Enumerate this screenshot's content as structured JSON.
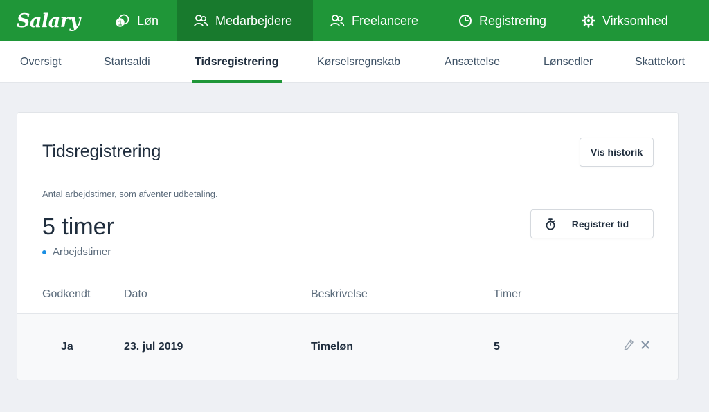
{
  "brand": {
    "logo": "Salary"
  },
  "topnav": [
    {
      "label": "Løn",
      "icon": "coin-icon",
      "active": false
    },
    {
      "label": "Medarbejdere",
      "icon": "users-icon",
      "active": true
    },
    {
      "label": "Freelancere",
      "icon": "users-icon",
      "active": false
    },
    {
      "label": "Registrering",
      "icon": "clock-icon",
      "active": false
    },
    {
      "label": "Virksomhed",
      "icon": "gear-icon",
      "active": false
    }
  ],
  "subnav": [
    {
      "label": "Oversigt",
      "active": false
    },
    {
      "label": "Startsaldi",
      "active": false
    },
    {
      "label": "Tidsregistrering",
      "active": true
    },
    {
      "label": "Kørselsregnskab",
      "active": false
    },
    {
      "label": "Ansættelse",
      "active": false
    },
    {
      "label": "Lønsedler",
      "active": false
    },
    {
      "label": "Skattekort",
      "active": false
    }
  ],
  "card": {
    "title": "Tidsregistrering",
    "history_button": "Vis historik",
    "register_button": "Registrer tid",
    "register_icon": "stopwatch-icon",
    "pending_description": "Antal arbejdstimer, som afventer udbetaling.",
    "pending_hours": "5 timer",
    "legend_label": "Arbejdstimer",
    "legend_color": "#1a8fe3"
  },
  "table": {
    "columns": [
      "Godkendt",
      "Dato",
      "Beskrivelse",
      "Timer"
    ],
    "rows": [
      {
        "approved": "Ja",
        "date": "23. jul 2019",
        "description": "Timeløn",
        "hours": "5"
      }
    ]
  },
  "colors": {
    "brand_green": "#1f9638",
    "active_green": "#187a2d"
  }
}
